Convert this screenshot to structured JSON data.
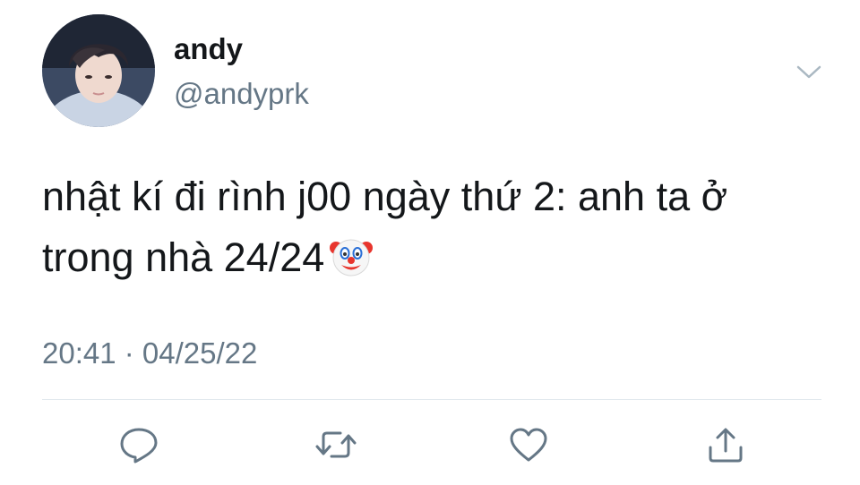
{
  "author": {
    "display_name": "andy",
    "handle": "@andyprk"
  },
  "tweet": {
    "text": "nhật kí đi rình j00 ngày thứ 2: anh ta ở trong nhà 24/24",
    "emoji": "clown-face-icon",
    "timestamp": "20:41 · 04/25/22"
  },
  "actions": [
    "reply-icon",
    "retweet-icon",
    "like-icon",
    "share-icon"
  ],
  "colors": {
    "text": "#14171a",
    "secondary": "#657786",
    "divider": "#e1e8ed",
    "icon": "#657786"
  }
}
